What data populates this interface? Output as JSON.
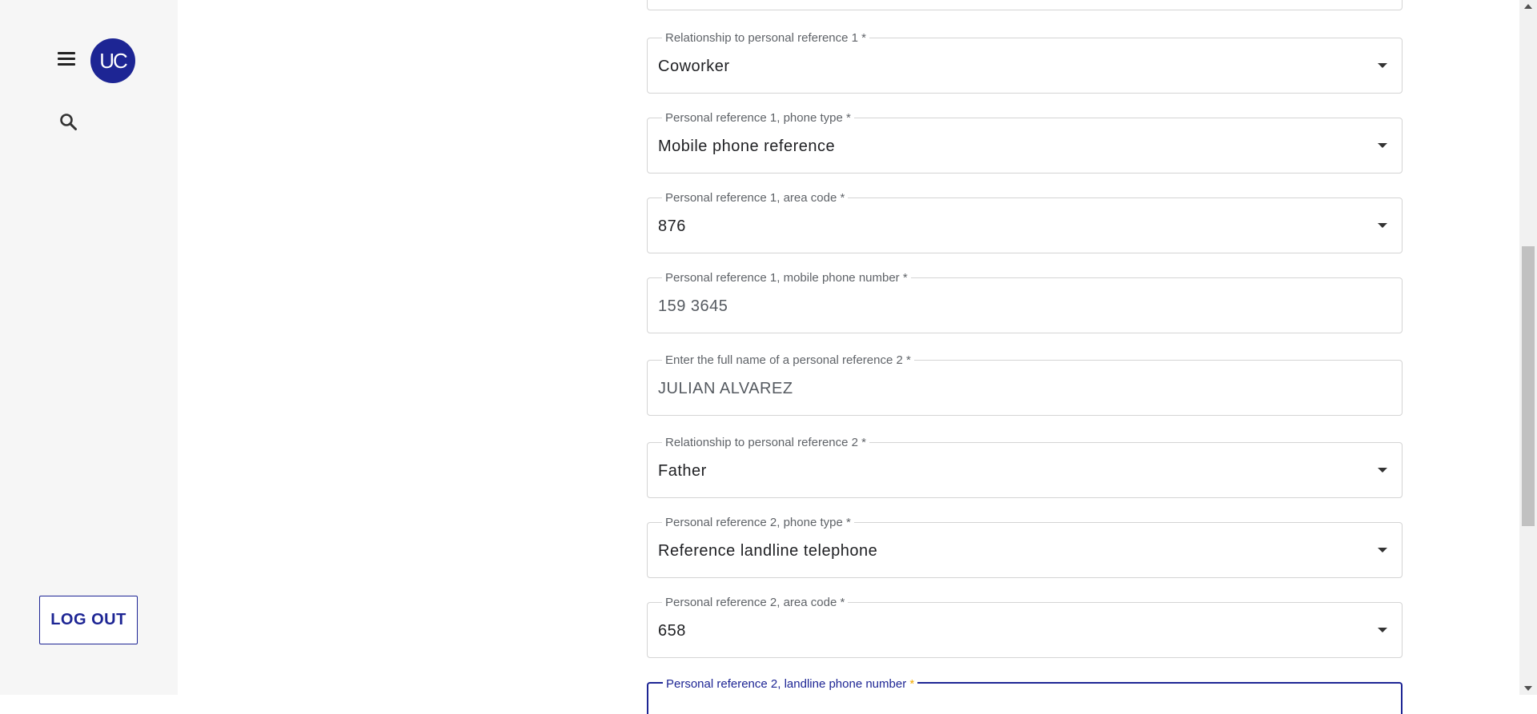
{
  "sidebar": {
    "avatar_initials": "UC",
    "logout_label": "LOG OUT"
  },
  "form": {
    "fields": [
      {
        "label": "Relationship to personal reference 1",
        "value": "Coworker"
      },
      {
        "label": "Personal reference 1, phone type",
        "value": "Mobile phone reference"
      },
      {
        "label": "Personal reference 1, area code",
        "value": "876"
      },
      {
        "label": "Personal reference 1, mobile phone number",
        "value": "159 3645"
      },
      {
        "label": "Enter the full name of a personal reference 2",
        "value": "JULIAN ALVAREZ"
      },
      {
        "label": "Relationship to personal reference 2",
        "value": "Father"
      },
      {
        "label": "Personal reference 2, phone type",
        "value": "Reference landline telephone"
      },
      {
        "label": "Personal reference 2, area code",
        "value": "658"
      },
      {
        "label": "Personal reference 2, landline phone number",
        "value": ""
      }
    ],
    "required_marker": "*"
  },
  "colors": {
    "brand": "#1d2594",
    "required_active": "#f2a900",
    "sidebar_bg": "#f6f6f6"
  }
}
